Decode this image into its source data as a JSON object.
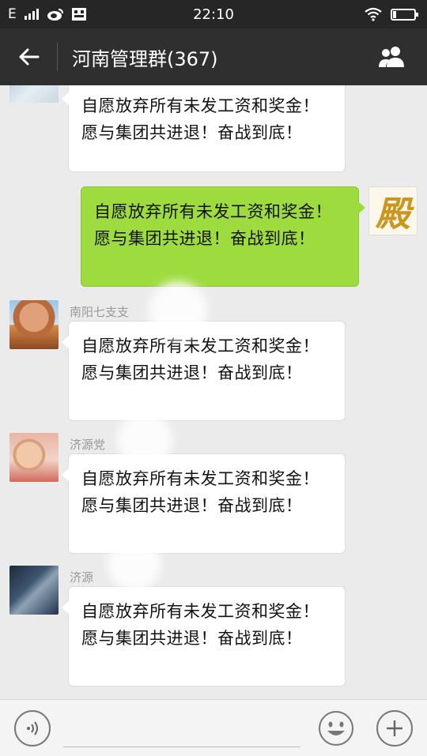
{
  "status_bar": {
    "network": "E",
    "time": "22:10",
    "battery_level": 0.15
  },
  "header": {
    "title": "河南管理群(367)"
  },
  "messages": [
    {
      "sender": "",
      "text": "自愿放弃所有未发工资和奖金！愿与集团共进退！奋战到底！",
      "direction": "in"
    },
    {
      "sender": "",
      "text": "自愿放弃所有未发工资和奖金！愿与集团共进退！奋战到底！",
      "direction": "out",
      "avatar_text": "殿"
    },
    {
      "sender": "南阳七支支",
      "text": "自愿放弃所有未发工资和奖金！愿与集团共进退！奋战到底！",
      "direction": "in"
    },
    {
      "sender": "济源党",
      "text": "自愿放弃所有未发工资和奖金！愿与集团共进退！奋战到底！",
      "direction": "in"
    },
    {
      "sender": "济源",
      "text": "自愿放弃所有未发工资和奖金！愿与集团共进退！奋战到底！",
      "direction": "in"
    }
  ],
  "input": {
    "value": ""
  },
  "colors": {
    "outgoing_bubble": "#9edb3f",
    "incoming_bubble": "#ffffff",
    "header_bg": "#2f2f2f"
  },
  "icons": [
    "back-arrow-icon",
    "group-members-icon",
    "voice-icon",
    "emoji-icon",
    "plus-icon",
    "wifi-icon",
    "weibo-icon"
  ]
}
